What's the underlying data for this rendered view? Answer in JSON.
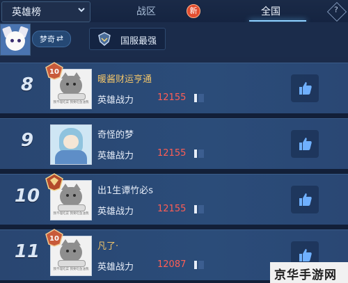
{
  "header": {
    "dropdown_label": "英雄榜",
    "tabs": [
      {
        "label": "战区",
        "badge": "新"
      },
      {
        "label": "全国"
      }
    ],
    "help_glyph": "?"
  },
  "profile": {
    "mode_label": "梦奇",
    "swap_glyph": "⇄",
    "region_label": "国服最强"
  },
  "rows": [
    {
      "rank": "8",
      "name": "暖酱财运亨通",
      "power_label": "英雄战力",
      "power": "12155",
      "badge_level": "10",
      "pic_caption": "我不理吃菜 我要吃鱼油我"
    },
    {
      "rank": "9",
      "name": "奇怪的梦",
      "power_label": "英雄战力",
      "power": "12155"
    },
    {
      "rank": "10",
      "name": "出1生谭竹必s",
      "power_label": "英雄战力",
      "power": "12155",
      "pic_caption": "我不理吃菜 我要吃鱼油我"
    },
    {
      "rank": "11",
      "name": "凡了·",
      "power_label": "英雄战力",
      "power": "12087",
      "badge_level": "10",
      "pic_caption": "我不理吃菜 我要吃鱼油我"
    }
  ],
  "watermark": "京华手游网",
  "colors": {
    "name_highlight": "#f0c46a",
    "power_value": "#ff5e55",
    "active_tab_underline": "#8fd0ff"
  },
  "icons": {
    "dropdown": "chevron-down-icon",
    "help": "help-icon",
    "region": "shield-icon",
    "like": "thumbs-up-icon",
    "flag": "flag-icon",
    "rank_badge": "rank-badge-icon"
  }
}
